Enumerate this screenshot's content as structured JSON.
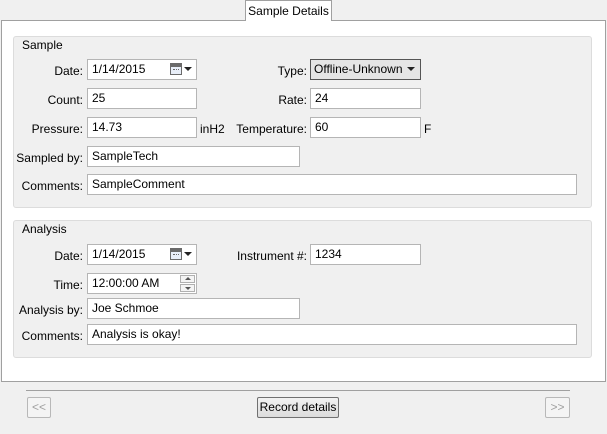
{
  "tabs": [
    {
      "label": "Sample Details",
      "active": true
    }
  ],
  "sample": {
    "title": "Sample",
    "date_label": "Date:",
    "date_value": "1/14/2015",
    "type_label": "Type:",
    "type_value": "Offline-Unknown",
    "count_label": "Count:",
    "count_value": "25",
    "rate_label": "Rate:",
    "rate_value": "24",
    "pressure_label": "Pressure:",
    "pressure_value": "14.73",
    "pressure_unit": "inH2",
    "temperature_label": "Temperature:",
    "temperature_value": "60",
    "temperature_unit": "F",
    "sampled_by_label": "Sampled by:",
    "sampled_by_value": "SampleTech",
    "comments_label": "Comments:",
    "comments_value": "SampleComment"
  },
  "analysis": {
    "title": "Analysis",
    "date_label": "Date:",
    "date_value": "1/14/2015",
    "instrument_label": "Instrument #:",
    "instrument_value": "1234",
    "time_label": "Time:",
    "time_value": "12:00:00 AM",
    "analysis_by_label": "Analysis by:",
    "analysis_by_value": "Joe Schmoe",
    "comments_label": "Comments:",
    "comments_value": "Analysis is okay!"
  },
  "footer": {
    "prev_label": "<<",
    "record_label": "Record details",
    "next_label": ">>"
  },
  "icons": {
    "date_picker": "calendar-icon",
    "dropdown": "chevron-down-icon",
    "spinner": "spin-up-down-icon"
  }
}
